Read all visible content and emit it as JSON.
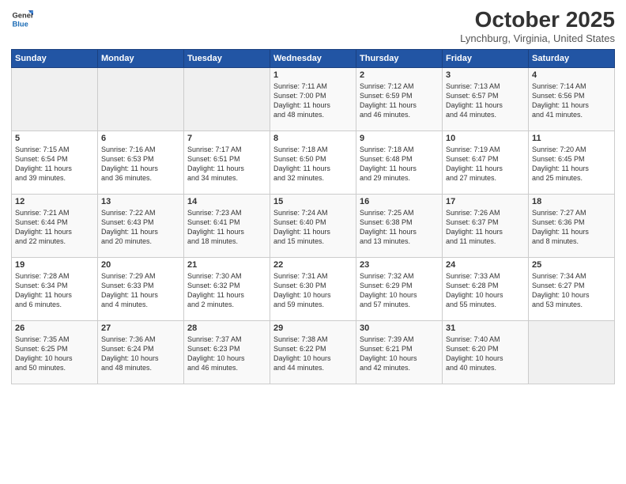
{
  "header": {
    "logo_general": "General",
    "logo_blue": "Blue",
    "month_title": "October 2025",
    "location": "Lynchburg, Virginia, United States"
  },
  "days_of_week": [
    "Sunday",
    "Monday",
    "Tuesday",
    "Wednesday",
    "Thursday",
    "Friday",
    "Saturday"
  ],
  "weeks": [
    [
      {
        "day": "",
        "info": ""
      },
      {
        "day": "",
        "info": ""
      },
      {
        "day": "",
        "info": ""
      },
      {
        "day": "1",
        "info": "Sunrise: 7:11 AM\nSunset: 7:00 PM\nDaylight: 11 hours\nand 48 minutes."
      },
      {
        "day": "2",
        "info": "Sunrise: 7:12 AM\nSunset: 6:59 PM\nDaylight: 11 hours\nand 46 minutes."
      },
      {
        "day": "3",
        "info": "Sunrise: 7:13 AM\nSunset: 6:57 PM\nDaylight: 11 hours\nand 44 minutes."
      },
      {
        "day": "4",
        "info": "Sunrise: 7:14 AM\nSunset: 6:56 PM\nDaylight: 11 hours\nand 41 minutes."
      }
    ],
    [
      {
        "day": "5",
        "info": "Sunrise: 7:15 AM\nSunset: 6:54 PM\nDaylight: 11 hours\nand 39 minutes."
      },
      {
        "day": "6",
        "info": "Sunrise: 7:16 AM\nSunset: 6:53 PM\nDaylight: 11 hours\nand 36 minutes."
      },
      {
        "day": "7",
        "info": "Sunrise: 7:17 AM\nSunset: 6:51 PM\nDaylight: 11 hours\nand 34 minutes."
      },
      {
        "day": "8",
        "info": "Sunrise: 7:18 AM\nSunset: 6:50 PM\nDaylight: 11 hours\nand 32 minutes."
      },
      {
        "day": "9",
        "info": "Sunrise: 7:18 AM\nSunset: 6:48 PM\nDaylight: 11 hours\nand 29 minutes."
      },
      {
        "day": "10",
        "info": "Sunrise: 7:19 AM\nSunset: 6:47 PM\nDaylight: 11 hours\nand 27 minutes."
      },
      {
        "day": "11",
        "info": "Sunrise: 7:20 AM\nSunset: 6:45 PM\nDaylight: 11 hours\nand 25 minutes."
      }
    ],
    [
      {
        "day": "12",
        "info": "Sunrise: 7:21 AM\nSunset: 6:44 PM\nDaylight: 11 hours\nand 22 minutes."
      },
      {
        "day": "13",
        "info": "Sunrise: 7:22 AM\nSunset: 6:43 PM\nDaylight: 11 hours\nand 20 minutes."
      },
      {
        "day": "14",
        "info": "Sunrise: 7:23 AM\nSunset: 6:41 PM\nDaylight: 11 hours\nand 18 minutes."
      },
      {
        "day": "15",
        "info": "Sunrise: 7:24 AM\nSunset: 6:40 PM\nDaylight: 11 hours\nand 15 minutes."
      },
      {
        "day": "16",
        "info": "Sunrise: 7:25 AM\nSunset: 6:38 PM\nDaylight: 11 hours\nand 13 minutes."
      },
      {
        "day": "17",
        "info": "Sunrise: 7:26 AM\nSunset: 6:37 PM\nDaylight: 11 hours\nand 11 minutes."
      },
      {
        "day": "18",
        "info": "Sunrise: 7:27 AM\nSunset: 6:36 PM\nDaylight: 11 hours\nand 8 minutes."
      }
    ],
    [
      {
        "day": "19",
        "info": "Sunrise: 7:28 AM\nSunset: 6:34 PM\nDaylight: 11 hours\nand 6 minutes."
      },
      {
        "day": "20",
        "info": "Sunrise: 7:29 AM\nSunset: 6:33 PM\nDaylight: 11 hours\nand 4 minutes."
      },
      {
        "day": "21",
        "info": "Sunrise: 7:30 AM\nSunset: 6:32 PM\nDaylight: 11 hours\nand 2 minutes."
      },
      {
        "day": "22",
        "info": "Sunrise: 7:31 AM\nSunset: 6:30 PM\nDaylight: 10 hours\nand 59 minutes."
      },
      {
        "day": "23",
        "info": "Sunrise: 7:32 AM\nSunset: 6:29 PM\nDaylight: 10 hours\nand 57 minutes."
      },
      {
        "day": "24",
        "info": "Sunrise: 7:33 AM\nSunset: 6:28 PM\nDaylight: 10 hours\nand 55 minutes."
      },
      {
        "day": "25",
        "info": "Sunrise: 7:34 AM\nSunset: 6:27 PM\nDaylight: 10 hours\nand 53 minutes."
      }
    ],
    [
      {
        "day": "26",
        "info": "Sunrise: 7:35 AM\nSunset: 6:25 PM\nDaylight: 10 hours\nand 50 minutes."
      },
      {
        "day": "27",
        "info": "Sunrise: 7:36 AM\nSunset: 6:24 PM\nDaylight: 10 hours\nand 48 minutes."
      },
      {
        "day": "28",
        "info": "Sunrise: 7:37 AM\nSunset: 6:23 PM\nDaylight: 10 hours\nand 46 minutes."
      },
      {
        "day": "29",
        "info": "Sunrise: 7:38 AM\nSunset: 6:22 PM\nDaylight: 10 hours\nand 44 minutes."
      },
      {
        "day": "30",
        "info": "Sunrise: 7:39 AM\nSunset: 6:21 PM\nDaylight: 10 hours\nand 42 minutes."
      },
      {
        "day": "31",
        "info": "Sunrise: 7:40 AM\nSunset: 6:20 PM\nDaylight: 10 hours\nand 40 minutes."
      },
      {
        "day": "",
        "info": ""
      }
    ]
  ]
}
